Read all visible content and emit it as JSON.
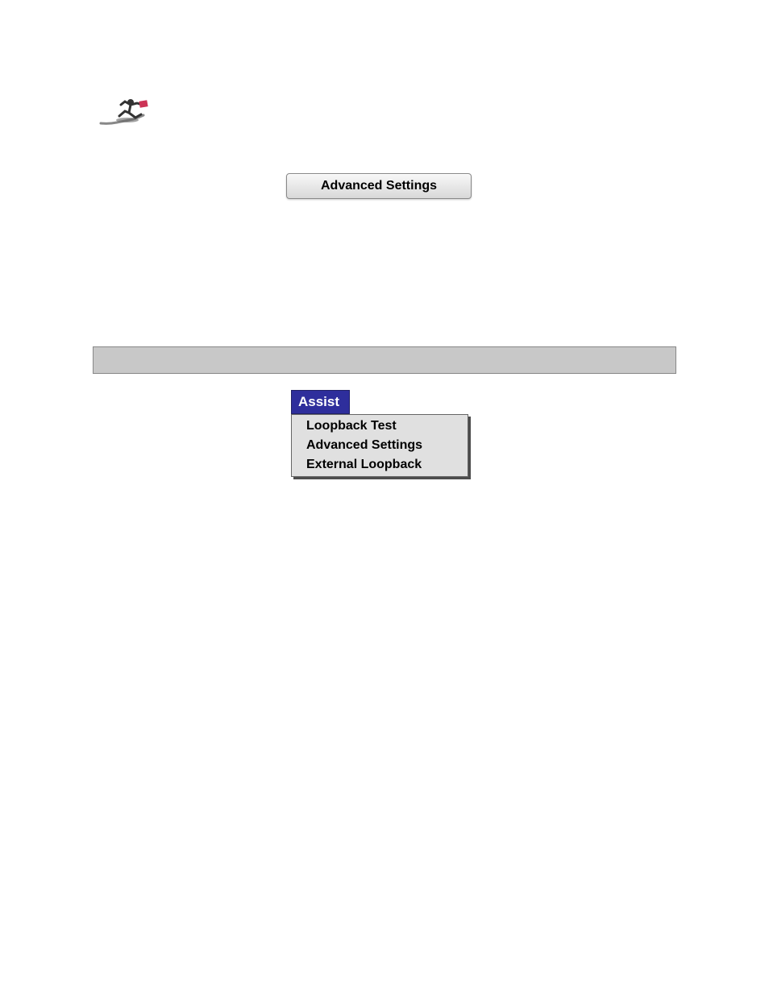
{
  "button": {
    "advanced_settings": "Advanced Settings"
  },
  "menu": {
    "title": "Assist",
    "items": [
      {
        "label": "Loopback Test"
      },
      {
        "label": "Advanced Settings"
      },
      {
        "label": "External Loopback"
      }
    ]
  }
}
